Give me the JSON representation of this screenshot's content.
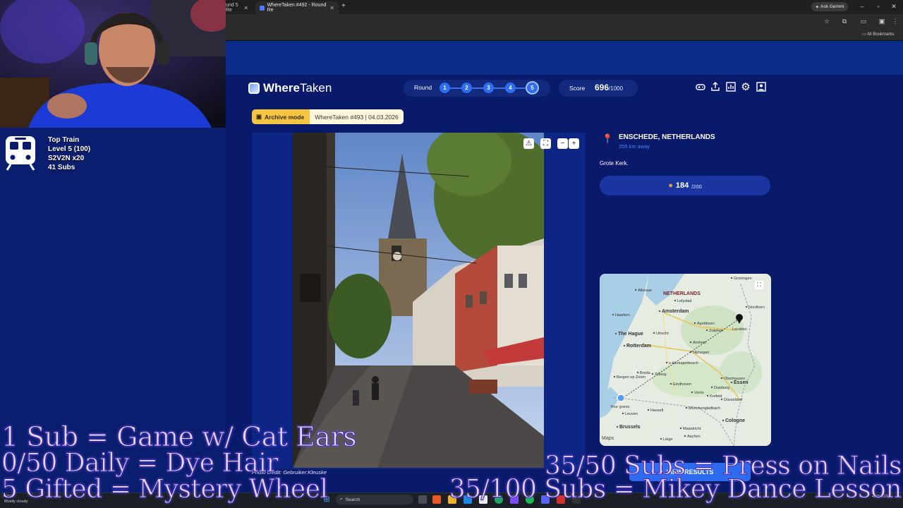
{
  "browser": {
    "tabs": [
      {
        "label": "und 5 Re",
        "close": "✕"
      },
      {
        "label": "WhereTaken #492 - Round Re",
        "close": "✕"
      }
    ],
    "new_tab": "+",
    "gemini_label": "Ask Gemini",
    "bookmarks_label": "All Bookmarks"
  },
  "app": {
    "logo_bold": "Where",
    "logo_light": "Taken",
    "round_label": "Round",
    "rounds": [
      "1",
      "2",
      "3",
      "4",
      "5"
    ],
    "current_round": 5,
    "score_label": "Score",
    "score_value": "696",
    "score_max": "/1000",
    "archive_badge": "Archive mode",
    "archive_info": "WhereTaken #493 | 04.03.2026",
    "header_icons": [
      "gamepad-icon",
      "share-icon",
      "stats-icon",
      "settings-icon",
      "profile-icon"
    ]
  },
  "result": {
    "location": "ENSCHEDE, NETHERLANDS",
    "distance": "205 km away",
    "description": "Grote Kerk.",
    "points": "184",
    "points_max": "/200",
    "photo_credit": "Photo credit: Gebruiker:Kleuske",
    "view_results": "VIEW RESULTS",
    "zoom_out": "−",
    "zoom_in": "+",
    "warn": "⚠",
    "fullscreen": "⛶"
  },
  "map": {
    "country_label": "NETHERLANDS",
    "location_label": "Location",
    "guess_label": "Your guess",
    "attribution": "Maps",
    "cities": [
      {
        "name": "Amsterdam",
        "big": true
      },
      {
        "name": "The Hague",
        "big": true
      },
      {
        "name": "Rotterdam",
        "big": true
      },
      {
        "name": "Utrecht"
      },
      {
        "name": "Apeldoorn"
      },
      {
        "name": "Zutphen"
      },
      {
        "name": "Arnhem"
      },
      {
        "name": "Nijmegen"
      },
      {
        "name": "Eindhoven"
      },
      {
        "name": "Tilburg"
      },
      {
        "name": "Breda"
      },
      {
        "name": "Duisburg"
      },
      {
        "name": "Essen",
        "big": true
      },
      {
        "name": "Düsseldorf"
      },
      {
        "name": "Cologne",
        "big": true
      },
      {
        "name": "Brussels",
        "big": true
      },
      {
        "name": "Maastricht"
      },
      {
        "name": "Haarlem"
      },
      {
        "name": "Alkmaar"
      },
      {
        "name": "Lelystad"
      },
      {
        "name": "Nordhorn"
      },
      {
        "name": "Krefeld"
      },
      {
        "name": "Venlo"
      },
      {
        "name": "Bergen op Zoom"
      },
      {
        "name": "Aachen"
      },
      {
        "name": "Mönchengladbach"
      },
      {
        "name": "Oberhausen"
      },
      {
        "name": "Liège"
      },
      {
        "name": "Leuven"
      },
      {
        "name": "Hasselt"
      },
      {
        "name": "s-Hertogenbosch"
      },
      {
        "name": "Groningen"
      }
    ]
  },
  "stream": {
    "train_title": "Top Train",
    "train_level": "Level 5  (100)",
    "train_user": "S2V2N x20",
    "train_subs": "41 Subs",
    "goals": [
      "1 Sub = Game w/ Cat Ears",
      "0/50 Daily = Dye Hair",
      "5 Gifted = Mystery Wheel",
      "35/50 Subs = Press on Nails",
      "35/100 Subs = Mikey Dance Lesson"
    ]
  },
  "taskbar": {
    "weather_temp": "47°F",
    "weather_text": "Mostly cloudy",
    "search_label": "Search",
    "time": "",
    "date": "4/29/2026"
  },
  "colors": {
    "page_bg": "#0a1a6b",
    "accent_blue": "#2e6cf0",
    "archive_yellow": "#f5c542",
    "goal_text": "#e9d4ff"
  }
}
